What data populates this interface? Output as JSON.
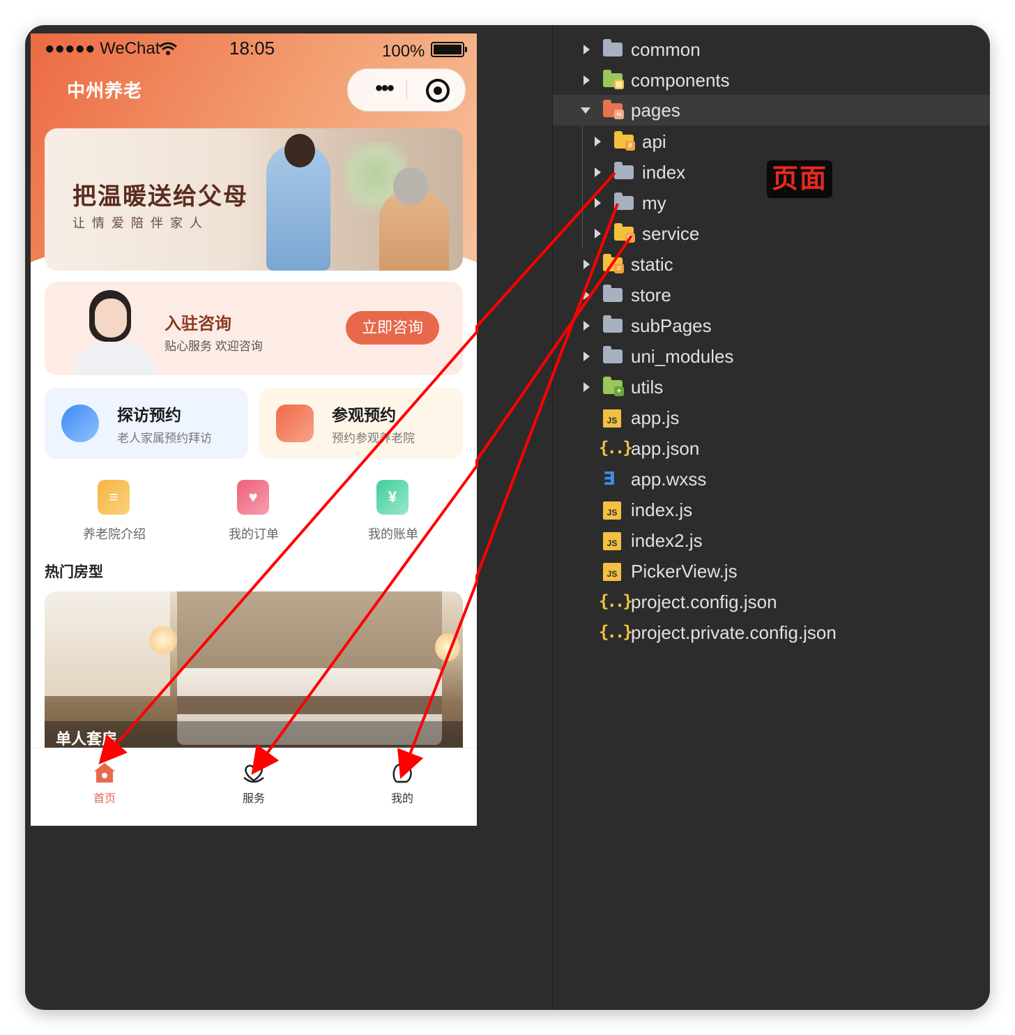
{
  "phone": {
    "status": {
      "carrier": "●●●●● WeChat",
      "time": "18:05",
      "battery": "100%"
    },
    "app_title": "中州养老",
    "capsule": {
      "more": "•••"
    },
    "banner": {
      "title": "把温暖送给父母",
      "subtitle": "让情爱陪伴家人"
    },
    "consult": {
      "title": "入驻咨询",
      "subtitle": "贴心服务 欢迎咨询",
      "button": "立即咨询"
    },
    "cards": [
      {
        "title": "探访预约",
        "subtitle": "老人家属预约拜访"
      },
      {
        "title": "参观预约",
        "subtitle": "预约参观养老院"
      }
    ],
    "quick": [
      {
        "label": "养老院介绍",
        "icon": "nursing-home-icon",
        "glyph": "≡"
      },
      {
        "label": "我的订单",
        "icon": "heart-order-icon",
        "glyph": "♥"
      },
      {
        "label": "我的账单",
        "icon": "yen-bill-icon",
        "glyph": "¥"
      }
    ],
    "section_title": "热门房型",
    "room": {
      "name": "单人套房"
    },
    "tabs": [
      {
        "label": "首页",
        "icon": "home-icon",
        "active": true,
        "color": "#e8684a"
      },
      {
        "label": "服务",
        "icon": "service-icon",
        "active": false
      },
      {
        "label": "我的",
        "icon": "profile-icon",
        "active": false
      }
    ]
  },
  "tree": {
    "items": [
      {
        "name": "common",
        "kind": "folder",
        "color": "grey",
        "expanded": false,
        "depth": 0
      },
      {
        "name": "components",
        "kind": "folder",
        "color": "green",
        "expanded": false,
        "depth": 0
      },
      {
        "name": "pages",
        "kind": "folder",
        "color": "orange",
        "expanded": true,
        "depth": 0,
        "selected": true
      },
      {
        "name": "api",
        "kind": "folder",
        "color": "yellow",
        "expanded": false,
        "depth": 1
      },
      {
        "name": "index",
        "kind": "folder",
        "color": "grey",
        "expanded": false,
        "depth": 1
      },
      {
        "name": "my",
        "kind": "folder",
        "color": "grey",
        "expanded": false,
        "depth": 1
      },
      {
        "name": "service",
        "kind": "folder",
        "color": "yellow",
        "expanded": false,
        "depth": 1
      },
      {
        "name": "static",
        "kind": "folder",
        "color": "yellow",
        "expanded": false,
        "depth": 0
      },
      {
        "name": "store",
        "kind": "folder",
        "color": "grey",
        "expanded": false,
        "depth": 0
      },
      {
        "name": "subPages",
        "kind": "folder",
        "color": "grey",
        "expanded": false,
        "depth": 0
      },
      {
        "name": "uni_modules",
        "kind": "folder",
        "color": "grey",
        "expanded": false,
        "depth": 0
      },
      {
        "name": "utils",
        "kind": "folder",
        "color": "green",
        "expanded": false,
        "depth": 0
      },
      {
        "name": "app.js",
        "kind": "js",
        "depth": 0
      },
      {
        "name": "app.json",
        "kind": "json",
        "depth": 0
      },
      {
        "name": "app.wxss",
        "kind": "css",
        "depth": 0
      },
      {
        "name": "index.js",
        "kind": "js",
        "depth": 0
      },
      {
        "name": "index2.js",
        "kind": "js",
        "depth": 0
      },
      {
        "name": "PickerView.js",
        "kind": "js",
        "depth": 0
      },
      {
        "name": "project.config.json",
        "kind": "json",
        "depth": 0
      },
      {
        "name": "project.private.config.json",
        "kind": "json",
        "depth": 0
      }
    ],
    "annotation": "页面"
  },
  "colors": {
    "accent": "#e8684a",
    "arrow": "#ff0000",
    "editor_bg": "#2c2c2c"
  }
}
